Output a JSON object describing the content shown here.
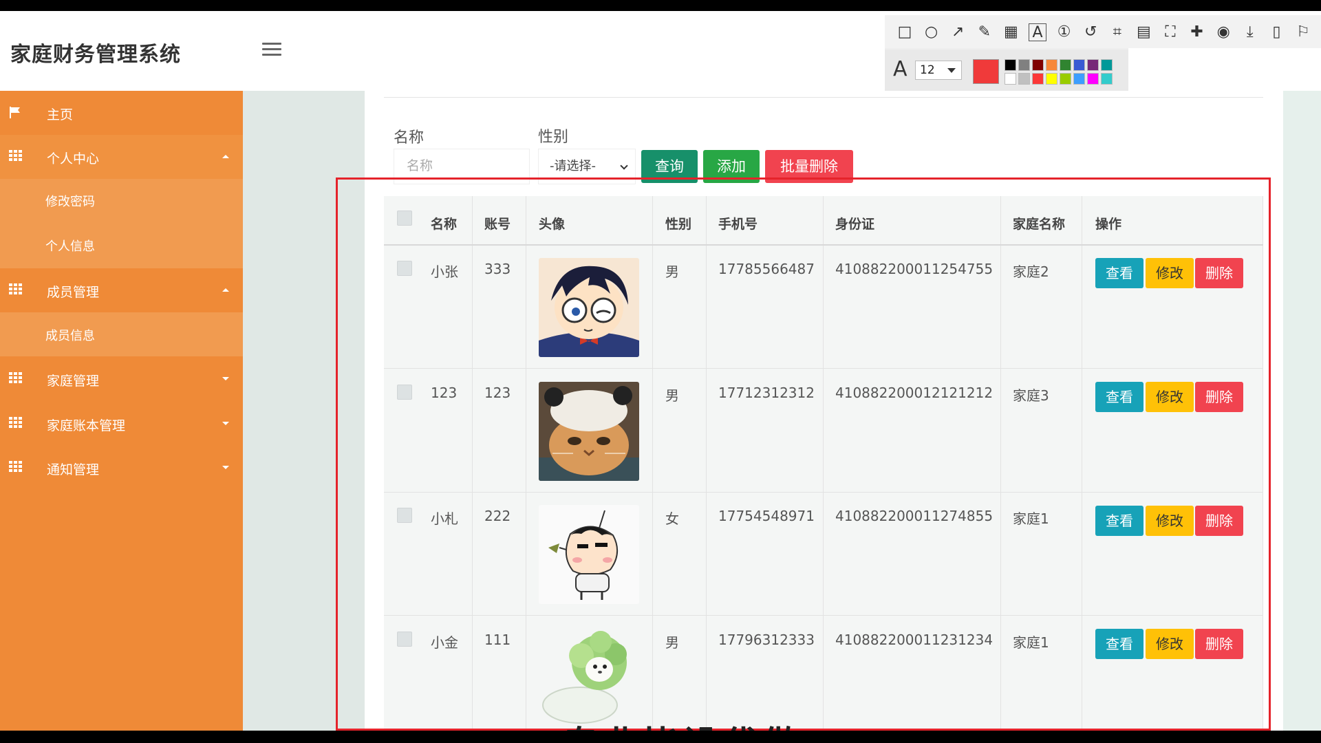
{
  "app": {
    "title": "家庭财务管理系统"
  },
  "toolbar": {
    "font_size": "12",
    "current_color": "#f03a3a",
    "tool_icons": [
      "rectangle-icon",
      "circle-icon",
      "arrow-icon",
      "pencil-icon",
      "mosaic-icon",
      "text-icon",
      "number-icon",
      "undo-icon",
      "crop-icon",
      "ocr-icon",
      "fullscreen-icon",
      "pin-icon",
      "record-icon",
      "download-icon",
      "save-icon",
      "bookmark-icon"
    ],
    "palette": [
      "#000000",
      "#808080",
      "#800000",
      "#f7883a",
      "#308430",
      "#385ad3",
      "#772878",
      "#009999",
      "#ffffff",
      "#c0c0c0",
      "#fb3838",
      "#ffff00",
      "#99cc00",
      "#3d9eff",
      "#ff00ff",
      "#33cccc"
    ]
  },
  "sidebar": {
    "home": "主页",
    "personal": {
      "label": "个人中心",
      "items": [
        "修改密码",
        "个人信息"
      ]
    },
    "members": {
      "label": "成员管理",
      "items": [
        "成员信息"
      ]
    },
    "family": "家庭管理",
    "account_book": "家庭账本管理",
    "notice": "通知管理"
  },
  "search": {
    "name_label": "名称",
    "name_placeholder": "名称",
    "gender_label": "性别",
    "gender_selected": "-请选择-",
    "query_btn": "查询",
    "add_btn": "添加",
    "batch_delete_btn": "批量删除"
  },
  "table": {
    "headers": [
      "名称",
      "账号",
      "头像",
      "性别",
      "手机号",
      "身份证",
      "家庭名称",
      "操作"
    ],
    "rows": [
      {
        "name": "小张",
        "account": "333",
        "gender": "男",
        "phone": "17785566487",
        "id_card": "410882200011254755",
        "family": "家庭2"
      },
      {
        "name": "123",
        "account": "123",
        "gender": "男",
        "phone": "17712312312",
        "id_card": "410882200012121212",
        "family": "家庭3"
      },
      {
        "name": "小札",
        "account": "222",
        "gender": "女",
        "phone": "17754548971",
        "id_card": "410882200011274855",
        "family": "家庭1"
      },
      {
        "name": "小金",
        "account": "111",
        "gender": "男",
        "phone": "17796312333",
        "id_card": "410882200011231234",
        "family": "家庭1"
      }
    ],
    "actions": {
      "view": "查看",
      "edit": "修改",
      "delete": "删除"
    }
  },
  "colors": {
    "sidebar": "#ef8a37",
    "query": "#17906a",
    "add": "#28a745",
    "danger": "#f1434f",
    "view": "#17a2b8",
    "edit": "#ffc107",
    "highlight": "#e5232b"
  },
  "overlay": {
    "subtitle": "专业毕设代做"
  }
}
